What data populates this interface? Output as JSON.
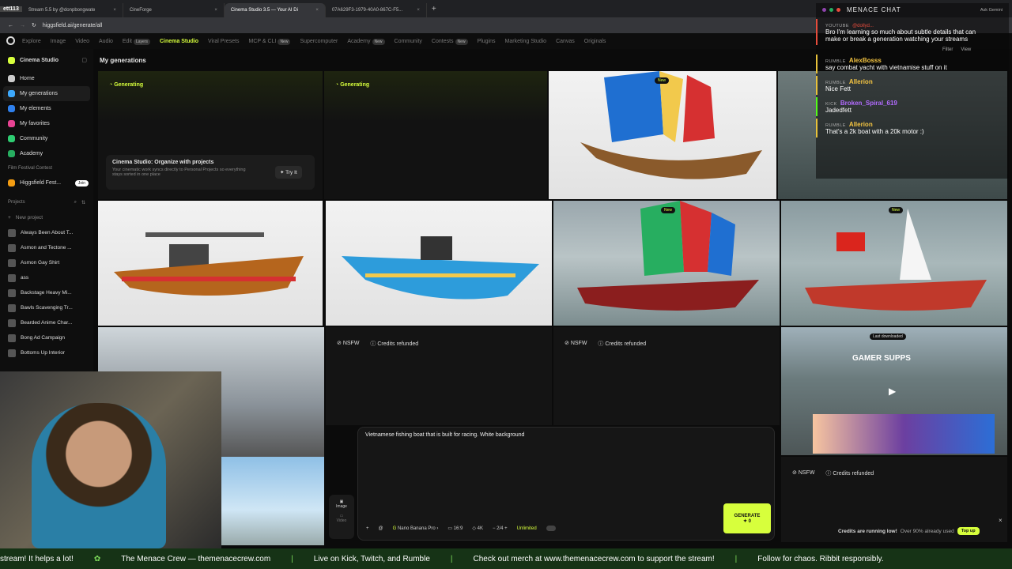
{
  "browser": {
    "tabs": [
      {
        "label": "Stream 5.5 by @donpbongwate"
      },
      {
        "label": "CineForge"
      },
      {
        "label": "Cinema Studio 3.5 — Your AI Di"
      },
      {
        "label": "07A629F3-1979-40A0-867C-F5..."
      }
    ],
    "url": "higgsfield.ai/generate/all",
    "counter": "ett113"
  },
  "nav": {
    "items": [
      "Explore",
      "Image",
      "Video",
      "Audio",
      "Edit",
      "Cinema Studio",
      "Viral Presets",
      "MCP & CLI",
      "Supercomputer",
      "Academy",
      "Community",
      "Contests",
      "Plugins",
      "Marketing Studio",
      "Canvas",
      "Originals"
    ],
    "active": "Cinema Studio",
    "badge_new": "New",
    "badge_layers": "Layers"
  },
  "sidebar": {
    "title": "Cinema Studio",
    "items": [
      {
        "label": "Home",
        "color": "#cccccc"
      },
      {
        "label": "My generations",
        "color": "#3da9fc"
      },
      {
        "label": "My elements",
        "color": "#2f80ed"
      },
      {
        "label": "My favorites",
        "color": "#e84393"
      },
      {
        "label": "Community",
        "color": "#2ecc71"
      },
      {
        "label": "Academy",
        "color": "#27ae60"
      }
    ],
    "festival_section": "Film Festival Contest",
    "festival_item": "Higgsfield Fest...",
    "join_label": "Join",
    "projects_section": "Projects",
    "new_project": "New project",
    "projects": [
      "Always Been About T...",
      "Asmon and Tectone ...",
      "Asmon Gay Shirt",
      "ass",
      "Backstage Heavy Mi...",
      "Bawls Scavenging Tr...",
      "Bearded Anime Char...",
      "Bong Ad Campaign",
      "Bottoms Up Interior"
    ]
  },
  "main": {
    "heading": "My generations",
    "generating_label": "Generating",
    "promo_title": "Cinema Studio: Organize with projects",
    "promo_body": "Your cinematic work syncs directly to Personal Projects so everything stays sorted in one place",
    "try_label": "Try It",
    "nsfw_label": "NSFW",
    "refunded_label": "Credits refunded",
    "new_badge": "New",
    "downloaded_badge": "Last downloaded",
    "car_banner": "GAMER SUPPS"
  },
  "prompt": {
    "text": "Vietnamese fishing boat that is built for racing. White background",
    "model": "Nano Banana Pro",
    "ratio": "16:9",
    "resolution": "4K",
    "count": "2/4",
    "unlimited": "Unlimited",
    "image_label": "Image",
    "video_label": "Video",
    "generate_label": "GENERATE",
    "generate_sub": "✦ 0"
  },
  "credits": {
    "text_bold": "Credits are running low!",
    "text": "Over 90% already used",
    "topup": "Top up"
  },
  "chat": {
    "title": "MENACE CHAT",
    "ask": "Ask Gemini",
    "filter": "Filter",
    "view": "View",
    "messages": [
      {
        "platform": "YOUTUBE",
        "user": "@dollyd...",
        "text": "Bro I'm learning so much about subtle details that can make or break a generation watching your streams"
      },
      {
        "platform": "RUMBLE",
        "user": "AlexBosss",
        "text": "say combat yacht with vietnamise stuff on it"
      },
      {
        "platform": "RUMBLE",
        "user": "Allerion",
        "text": "Nice Fett"
      },
      {
        "platform": "KICK",
        "user": "Broken_Spiral_619",
        "text": "Jadedfett"
      },
      {
        "platform": "RUMBLE",
        "user": "Allerion",
        "text": "That's a 2k boat with a 20k motor :)"
      }
    ]
  },
  "ticker": {
    "items": [
      "stream! It helps a lot!",
      "The Menace Crew — themenacecrew.com",
      "Live on Kick, Twitch, and Rumble",
      "Check out merch at www.themenacecrew.com to support the stream!",
      "Follow for chaos. Ribbit responsibly."
    ]
  }
}
